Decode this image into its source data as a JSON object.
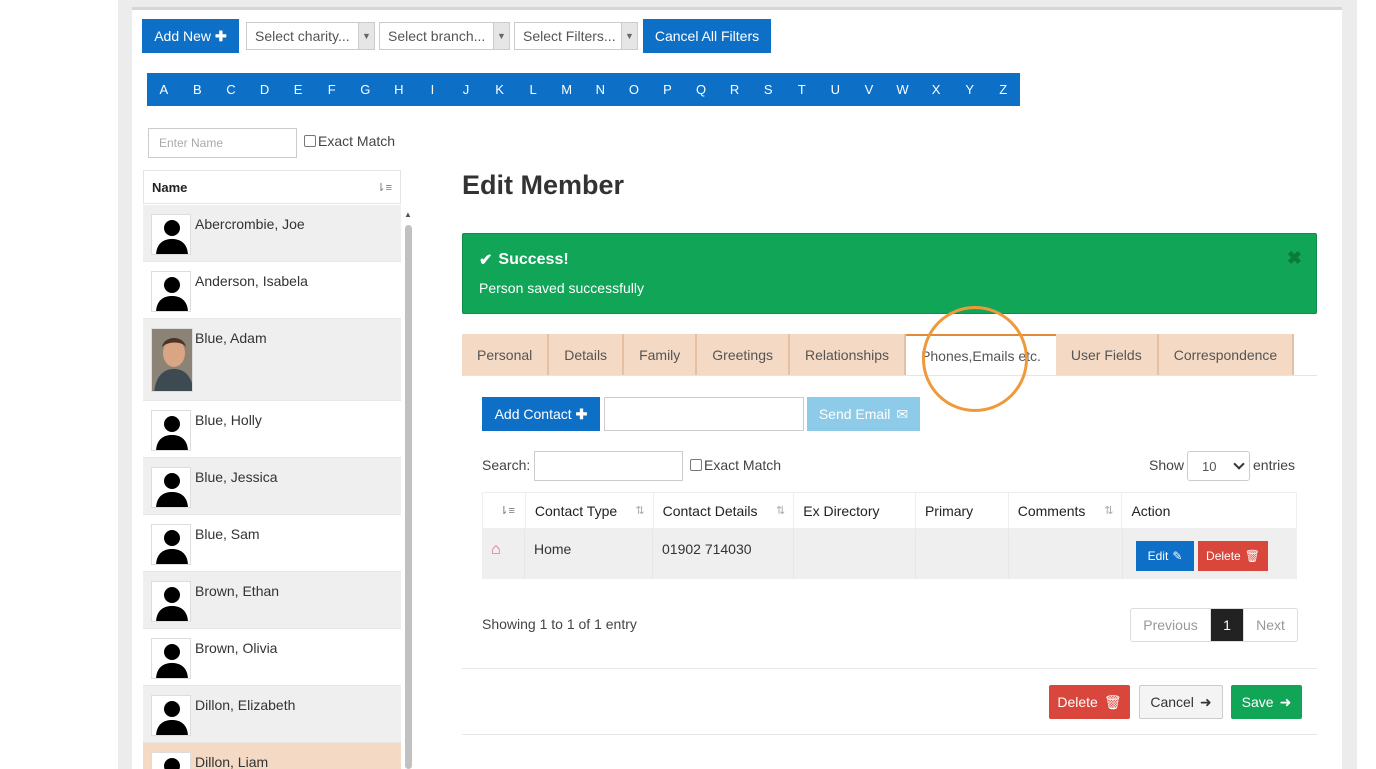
{
  "toolbar": {
    "add_new": "Add New",
    "charity_placeholder": "Select charity...",
    "branch_placeholder": "Select branch...",
    "filters_placeholder": "Select Filters...",
    "cancel_filters": "Cancel All Filters"
  },
  "alphabet": [
    "A",
    "B",
    "C",
    "D",
    "E",
    "F",
    "G",
    "H",
    "I",
    "J",
    "K",
    "L",
    "M",
    "N",
    "O",
    "P",
    "Q",
    "R",
    "S",
    "T",
    "U",
    "V",
    "W",
    "X",
    "Y",
    "Z"
  ],
  "search": {
    "name_placeholder": "Enter Name",
    "exact_match": "Exact Match"
  },
  "member_list": {
    "header": "Name",
    "members": [
      {
        "name": "Abercrombie, Joe"
      },
      {
        "name": "Anderson, Isabela"
      },
      {
        "name": "Blue, Adam"
      },
      {
        "name": "Blue, Holly"
      },
      {
        "name": "Blue, Jessica"
      },
      {
        "name": "Blue, Sam"
      },
      {
        "name": "Brown, Ethan"
      },
      {
        "name": "Brown, Olivia"
      },
      {
        "name": "Dillon, Elizabeth"
      },
      {
        "name": "Dillon, Liam"
      }
    ]
  },
  "main": {
    "title": "Edit Member",
    "alert": {
      "title": "Success!",
      "message": "Person saved successfully",
      "close": "✖"
    },
    "tabs": [
      "Personal",
      "Details",
      "Family",
      "Greetings",
      "Relationships",
      "Phones,Emails etc.",
      "User Fields",
      "Correspondence"
    ],
    "active_tab": "Phones,Emails etc.",
    "add_contact": "Add Contact",
    "send_email": "Send Email",
    "search_label": "Search:",
    "exact_match": "Exact Match",
    "show_label": "Show",
    "show_value": "10",
    "entries_label": "entries",
    "columns": [
      "",
      "Contact Type",
      "Contact Details",
      "Ex Directory",
      "Primary",
      "Comments",
      "Action"
    ],
    "rows": [
      {
        "icon": "home-icon",
        "type": "Home",
        "details": "01902 714030",
        "ex_directory": "",
        "primary": "",
        "comments": "",
        "edit": "Edit",
        "delete": "Delete"
      }
    ],
    "showing": "Showing 1 to 1 of 1 entry",
    "pagination": {
      "previous": "Previous",
      "current": "1",
      "next": "Next"
    },
    "actions": {
      "delete": "Delete",
      "cancel": "Cancel",
      "save": "Save"
    }
  }
}
